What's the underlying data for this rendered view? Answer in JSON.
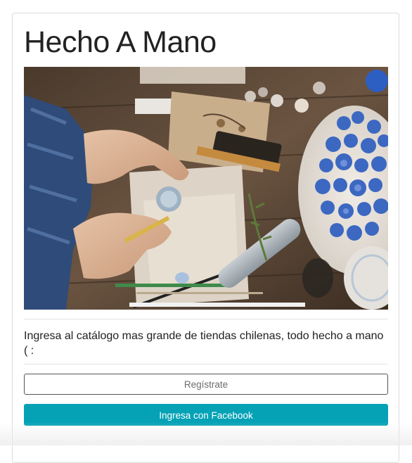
{
  "card": {
    "title": "Hecho A Mano",
    "description": "Ingresa al catálogo mas grande de tiendas chilenas, todo hecho a mano ( :",
    "buttons": {
      "register_label": "Regístrate",
      "facebook_label": "Ingresa con Facebook"
    },
    "hero_image": "crafts-workspace-photo"
  },
  "colors": {
    "facebook_button": "#05a2b6",
    "register_border": "#555555",
    "title_text": "#222222"
  }
}
